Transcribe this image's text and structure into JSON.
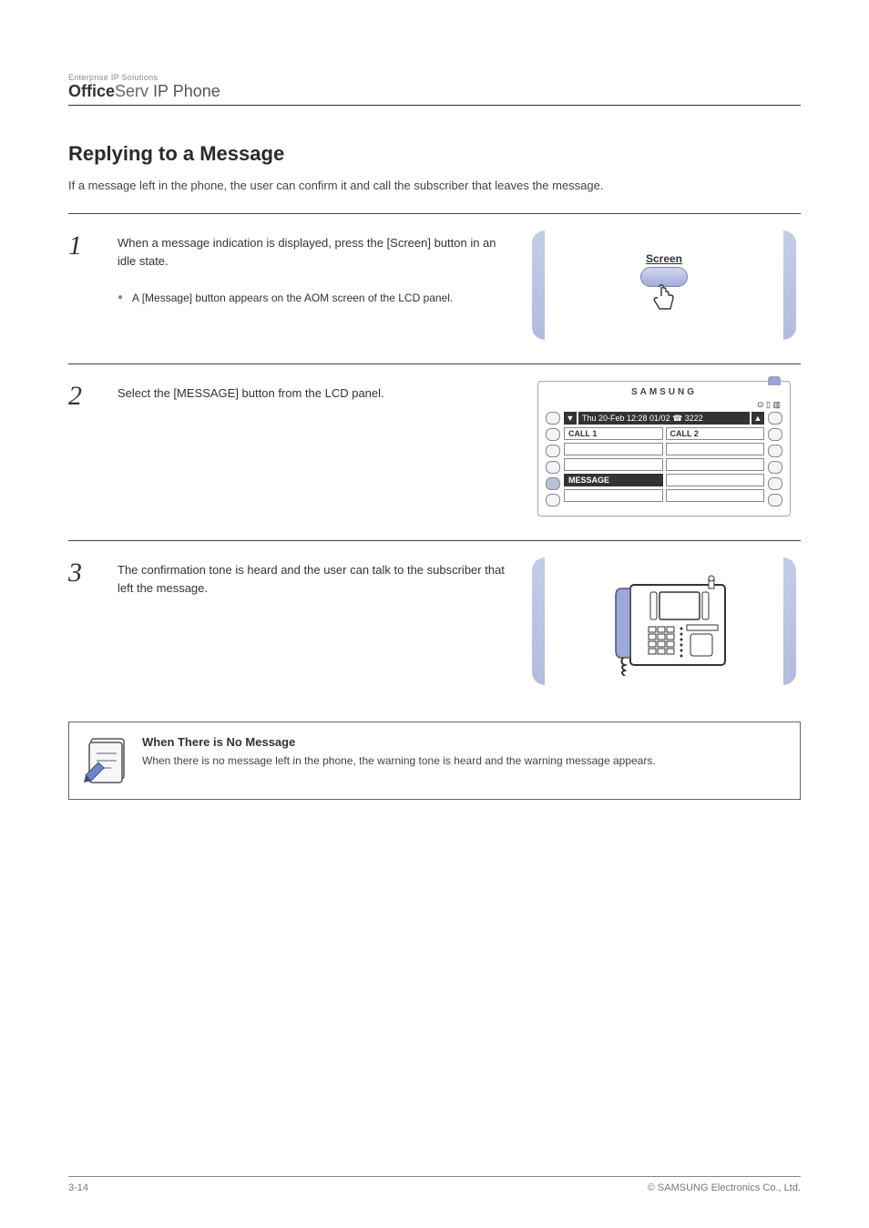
{
  "header": {
    "tagline": "Enterprise IP Solutions",
    "brand_bold": "Office",
    "brand_light": "Serv",
    "brand_suffix": " IP Phone"
  },
  "section": {
    "title": "Replying to a Message",
    "desc": "If a message left in the phone, the user can confirm it and call the subscriber that leaves the message."
  },
  "steps": [
    {
      "num": "1",
      "text": "When a message indication is displayed, press the [Screen] button in an idle state.",
      "bullet": "A [Message] button appears on the AOM screen of the LCD panel.",
      "illus": "screen_button",
      "screen_label": "Screen"
    },
    {
      "num": "2",
      "text": "Select the [MESSAGE] button from the LCD panel.",
      "illus": "lcd",
      "lcd": {
        "brand": "SAMSUNG",
        "icons": "⊙ ▯ ▥",
        "datebar": "Thu 20-Feb 12:28 01/02 ☎ 3222",
        "arrow_down": "▼",
        "arrow_up": "▲",
        "row1": [
          "CALL 1",
          "CALL 2"
        ],
        "row2": [
          "",
          ""
        ],
        "row3": [
          "",
          ""
        ],
        "row4": [
          "MESSAGE",
          ""
        ],
        "row5": [
          "",
          ""
        ]
      }
    },
    {
      "num": "3",
      "text": "The confirmation tone is heard and the user can talk to the subscriber that left the message.",
      "illus": "phone_device"
    }
  ],
  "note": {
    "title": "When There is No Message",
    "text": "When there is no message left in the phone, the warning tone is heard and the warning message appears."
  },
  "footer": {
    "left": "3-14",
    "right": "© SAMSUNG Electronics Co., Ltd."
  }
}
